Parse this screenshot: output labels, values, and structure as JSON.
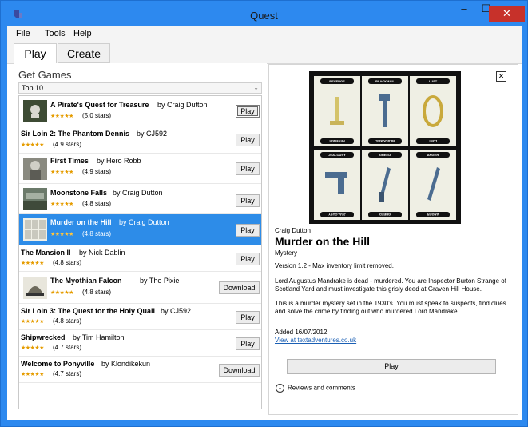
{
  "window": {
    "title": "Quest",
    "minimize": "–",
    "maximize": "☐",
    "close": "✕"
  },
  "menu": [
    "File",
    "Tools",
    "Help"
  ],
  "tabs": [
    {
      "label": "Play",
      "active": true
    },
    {
      "label": "Create",
      "active": false
    }
  ],
  "games_panel": {
    "heading": "Get Games",
    "filter": "Top 10",
    "games": [
      {
        "title": "A Pirate's Quest for Treasure",
        "author": "by Craig Dutton",
        "rating": "(5.0 stars)",
        "stars": "★★★★★",
        "button": "Play",
        "has_thumb": true,
        "focused": true
      },
      {
        "title": "Sir Loin 2: The Phantom Dennis",
        "author": "by CJ592",
        "rating": "(4.9 stars)",
        "stars": "★★★★★",
        "button": "Play",
        "has_thumb": false
      },
      {
        "title": "First Times",
        "author": "by Hero Robb",
        "rating": "(4.9 stars)",
        "stars": "★★★★★",
        "button": "Play",
        "has_thumb": true
      },
      {
        "title": "Moonstone Falls",
        "author": "by Craig Dutton",
        "rating": "(4.8 stars)",
        "stars": "★★★★★",
        "button": "Play",
        "has_thumb": true
      },
      {
        "title": "Murder on the Hill",
        "author": "by Craig Dutton",
        "rating": "(4.8 stars)",
        "stars": "★★★★★",
        "button": "Play",
        "has_thumb": true,
        "selected": true
      },
      {
        "title": "The Mansion II",
        "author": "by Nick Dablin",
        "rating": "(4.8 stars)",
        "stars": "★★★★★",
        "button": "Play",
        "has_thumb": false
      },
      {
        "title": "The Myothian Falcon",
        "author": "by The Pixie",
        "rating": "(4.8 stars)",
        "stars": "★★★★★",
        "button": "Download",
        "has_thumb": true
      },
      {
        "title": "Sir Loin 3: The Quest for the Holy Quail",
        "author": "by CJ592",
        "rating": "(4.8 stars)",
        "stars": "★★★★★",
        "button": "Play",
        "has_thumb": false
      },
      {
        "title": "Shipwrecked",
        "author": "by Tim Hamilton",
        "rating": "(4.7 stars)",
        "stars": "★★★★★",
        "button": "Play",
        "has_thumb": false
      },
      {
        "title": "Welcome to Ponyville",
        "author": "by Klondikekun",
        "rating": "(4.7 stars)",
        "stars": "★★★★★",
        "button": "Download",
        "has_thumb": false
      }
    ]
  },
  "detail": {
    "close": "✕",
    "author": "Craig Dutton",
    "title": "Murder on the Hill",
    "genre": "Mystery",
    "version": "Version 1.2 - Max inventory limit removed.",
    "desc1": "Lord Augustus Mandrake is dead - murdered. You are Inspector Burton Strange of Scotland Yard and must investigate this grisly deed at Graven Hill House.",
    "desc2": "This is a murder mystery set in the 1930's. You must speak to suspects, find clues and solve the crime by finding out who murdered Lord Mandrake.",
    "added": "Added 16/07/2012",
    "link": "View at textadventures.co.uk",
    "play": "Play",
    "reviews": "Reviews and comments",
    "cover_cards": [
      "REVENGE",
      "BLACKMAIL",
      "LUST",
      "JEALOUSY",
      "GREED",
      "ANGER"
    ]
  },
  "colors": {
    "accent": "#2d8ce8",
    "frame": "#2d89ef",
    "close": "#c7312a",
    "stars": "#e59c00"
  }
}
